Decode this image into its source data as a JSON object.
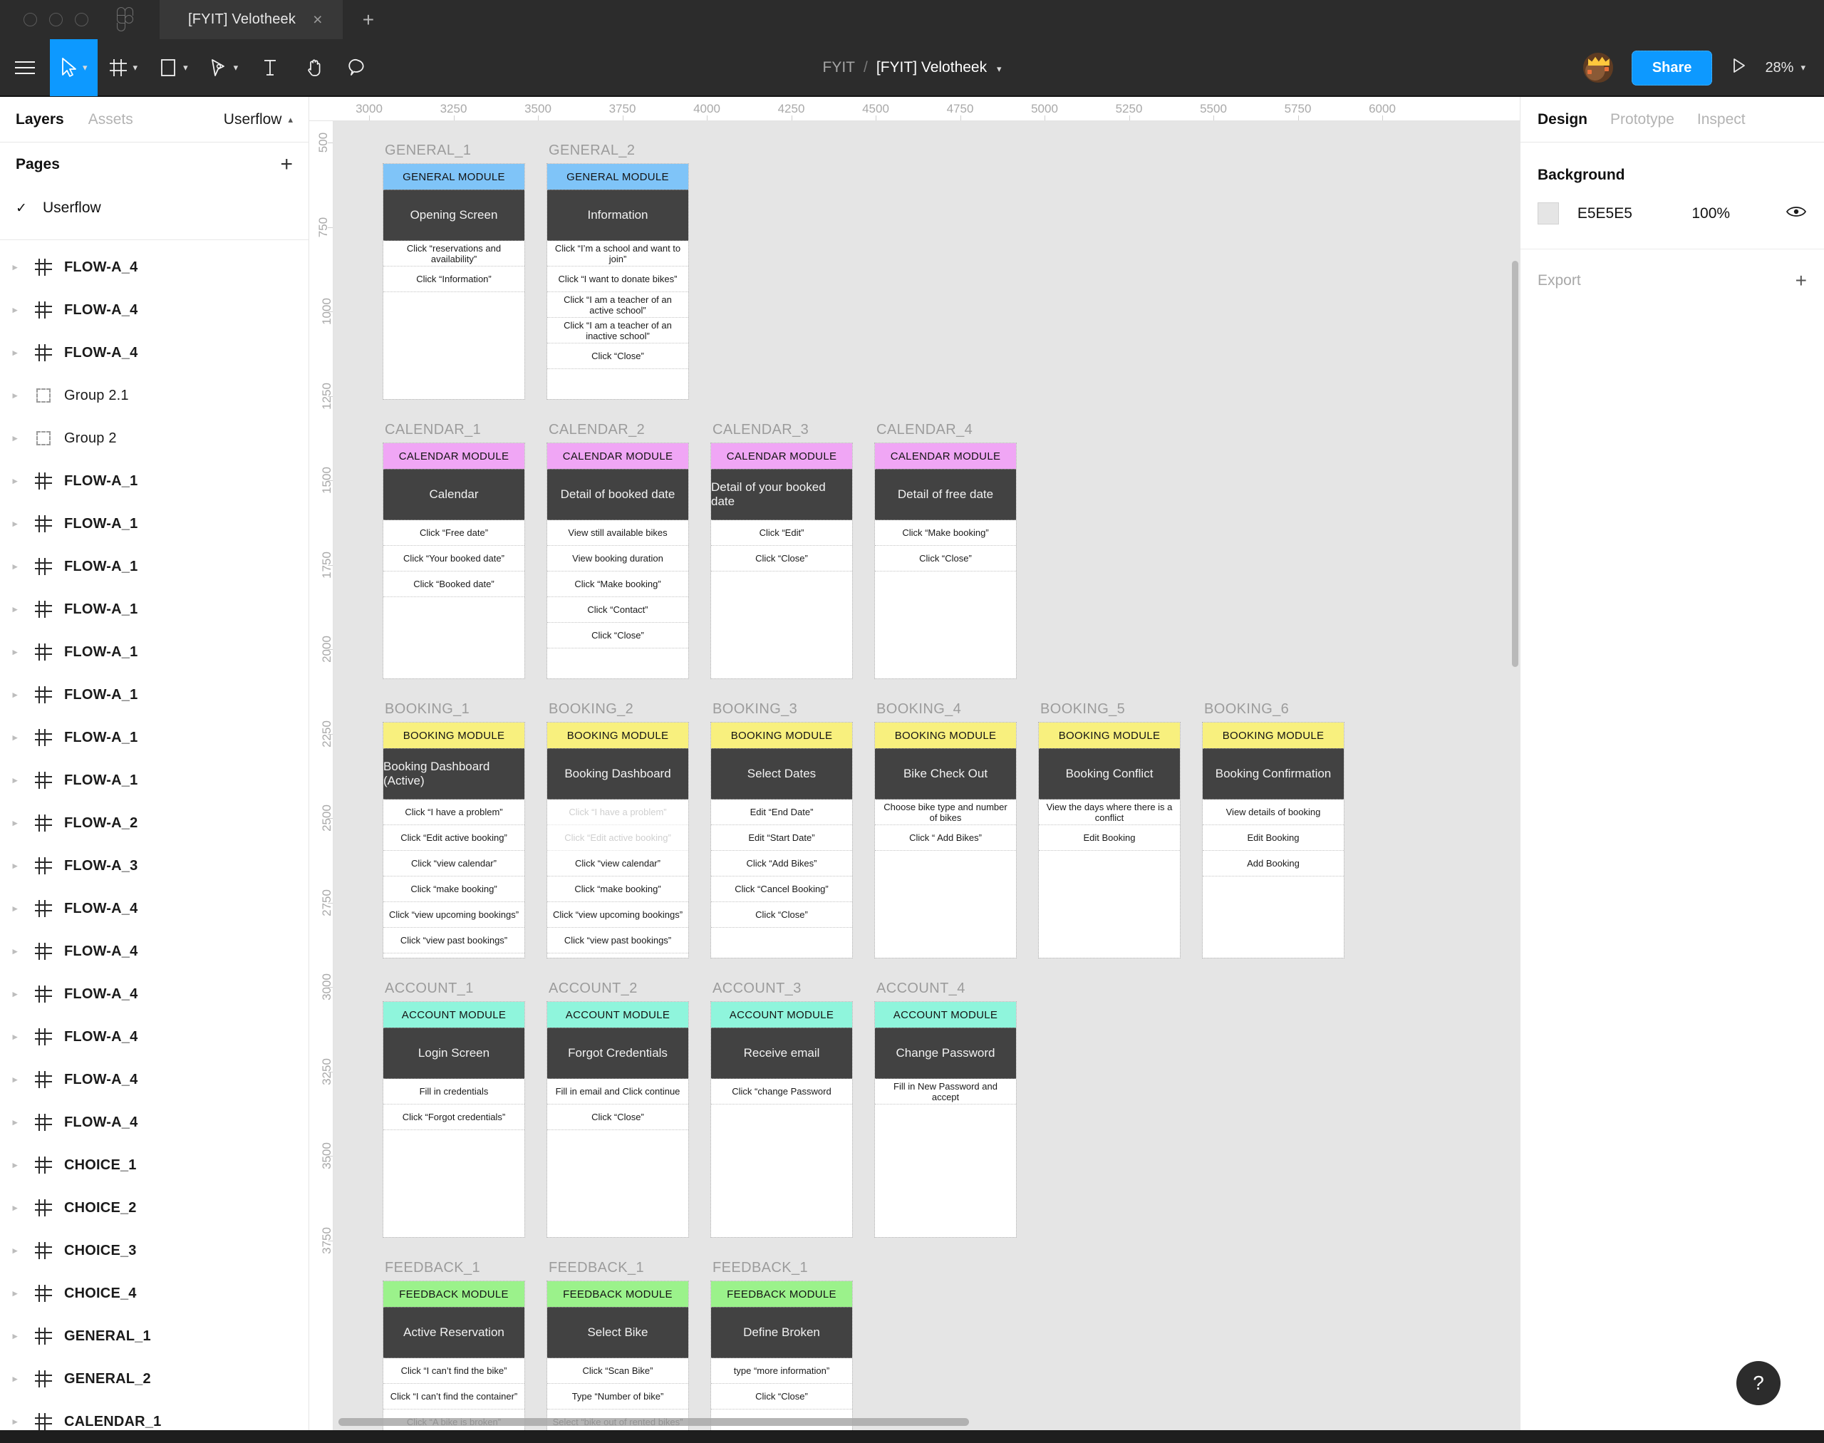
{
  "window": {
    "traffic_lights": [
      "close",
      "minimize",
      "maximize"
    ],
    "app_logo": "figma-logo",
    "tab_title": "[FYIT] Velotheek",
    "tab_close": "×",
    "new_tab": "+"
  },
  "toolbar": {
    "menu_icon": "hamburger-icon",
    "tools": [
      {
        "name": "move-tool",
        "icon": "cursor-arrow-icon",
        "active": true,
        "caret": "∨"
      },
      {
        "name": "frame-tool",
        "icon": "frame-icon",
        "active": false,
        "caret": "∨"
      },
      {
        "name": "shape-tool",
        "icon": "rectangle-icon",
        "active": false,
        "caret": "∨"
      },
      {
        "name": "pen-tool",
        "icon": "pen-icon",
        "active": false,
        "caret": "∨"
      },
      {
        "name": "text-tool",
        "icon": "text-icon",
        "active": false,
        "caret": ""
      },
      {
        "name": "hand-tool",
        "icon": "hand-icon",
        "active": false,
        "caret": ""
      },
      {
        "name": "comment-tool",
        "icon": "comment-icon",
        "active": false,
        "caret": ""
      }
    ],
    "breadcrumb": {
      "team": "FYIT",
      "separator": "/",
      "file": "[FYIT] Velotheek",
      "caret": "∨"
    },
    "avatar": "user-avatar",
    "share_label": "Share",
    "present_icon": "play-icon",
    "zoom_level": "28%",
    "zoom_caret": "∨"
  },
  "left_panel": {
    "tabs": [
      {
        "label": "Layers",
        "active": true
      },
      {
        "label": "Assets",
        "active": false
      }
    ],
    "page_selector": {
      "label": "Userflow",
      "caret": "^"
    },
    "pages": {
      "header": "Pages",
      "add_icon": "plus-icon",
      "items": [
        {
          "label": "Userflow",
          "checked": true,
          "check_glyph": "✓"
        }
      ]
    },
    "layers": [
      {
        "name": "FLOW-A_4",
        "type": "frame"
      },
      {
        "name": "FLOW-A_4",
        "type": "frame"
      },
      {
        "name": "FLOW-A_4",
        "type": "frame"
      },
      {
        "name": "Group 2.1",
        "type": "group"
      },
      {
        "name": "Group 2",
        "type": "group"
      },
      {
        "name": "FLOW-A_1",
        "type": "frame"
      },
      {
        "name": "FLOW-A_1",
        "type": "frame"
      },
      {
        "name": "FLOW-A_1",
        "type": "frame"
      },
      {
        "name": "FLOW-A_1",
        "type": "frame"
      },
      {
        "name": "FLOW-A_1",
        "type": "frame"
      },
      {
        "name": "FLOW-A_1",
        "type": "frame"
      },
      {
        "name": "FLOW-A_1",
        "type": "frame"
      },
      {
        "name": "FLOW-A_1",
        "type": "frame"
      },
      {
        "name": "FLOW-A_2",
        "type": "frame"
      },
      {
        "name": "FLOW-A_3",
        "type": "frame"
      },
      {
        "name": "FLOW-A_4",
        "type": "frame"
      },
      {
        "name": "FLOW-A_4",
        "type": "frame"
      },
      {
        "name": "FLOW-A_4",
        "type": "frame"
      },
      {
        "name": "FLOW-A_4",
        "type": "frame"
      },
      {
        "name": "FLOW-A_4",
        "type": "frame"
      },
      {
        "name": "FLOW-A_4",
        "type": "frame"
      },
      {
        "name": "CHOICE_1",
        "type": "frame"
      },
      {
        "name": "CHOICE_2",
        "type": "frame"
      },
      {
        "name": "CHOICE_3",
        "type": "frame"
      },
      {
        "name": "CHOICE_4",
        "type": "frame"
      },
      {
        "name": "GENERAL_1",
        "type": "frame"
      },
      {
        "name": "GENERAL_2",
        "type": "frame"
      },
      {
        "name": "CALENDAR_1",
        "type": "frame"
      }
    ]
  },
  "right_panel": {
    "tabs": [
      {
        "label": "Design",
        "active": true
      },
      {
        "label": "Prototype",
        "active": false
      },
      {
        "label": "Inspect",
        "active": false
      }
    ],
    "background": {
      "title": "Background",
      "color_hex": "E5E5E5",
      "opacity": "100%",
      "visibility_icon": "eye-icon"
    },
    "export": {
      "title": "Export",
      "add_icon": "plus-icon"
    }
  },
  "canvas": {
    "ruler_h": [
      3000,
      3250,
      3500,
      3750,
      4000,
      4250,
      4500,
      4750,
      5000,
      5250,
      5500,
      5750,
      6000
    ],
    "ruler_v": [
      500,
      750,
      1000,
      1250,
      1500,
      1750,
      2000,
      2250,
      2500,
      2750,
      3000,
      3250,
      3500,
      3750
    ],
    "module_colors": {
      "general": "#7FC4F8",
      "calendar": "#F0A6F5",
      "booking": "#F8F07E",
      "account": "#8FF5DC",
      "feedback": "#9BF28B"
    },
    "frames": [
      {
        "name": "GENERAL_1",
        "module": "GENERAL MODULE",
        "module_key": "general",
        "title": "Opening Screen",
        "rows": [
          {
            "text": "Click “reservations and availability”",
            "disabled": false
          },
          {
            "text": "Click “Information”",
            "disabled": false
          }
        ]
      },
      {
        "name": "GENERAL_2",
        "module": "GENERAL MODULE",
        "module_key": "general",
        "title": "Information",
        "rows": [
          {
            "text": "Click “I’m a school and want to join”",
            "disabled": false
          },
          {
            "text": "Click “I want to donate bikes”",
            "disabled": false
          },
          {
            "text": "Click “I am a teacher of an active school”",
            "disabled": false
          },
          {
            "text": "Click “I am a teacher of an inactive school”",
            "disabled": false
          },
          {
            "text": "Click “Close”",
            "disabled": false
          }
        ]
      },
      {
        "name": "CALENDAR_1",
        "module": "CALENDAR MODULE",
        "module_key": "calendar",
        "title": "Calendar",
        "rows": [
          {
            "text": "Click “Free date”",
            "disabled": false
          },
          {
            "text": "Click “Your booked date”",
            "disabled": false
          },
          {
            "text": "Click “Booked date”",
            "disabled": false
          }
        ]
      },
      {
        "name": "CALENDAR_2",
        "module": "CALENDAR MODULE",
        "module_key": "calendar",
        "title": "Detail of booked date",
        "rows": [
          {
            "text": "View still available bikes",
            "disabled": false
          },
          {
            "text": "View booking duration",
            "disabled": false
          },
          {
            "text": "Click “Make booking”",
            "disabled": false
          },
          {
            "text": "Click “Contact”",
            "disabled": false
          },
          {
            "text": "Click “Close”",
            "disabled": false
          }
        ]
      },
      {
        "name": "CALENDAR_3",
        "module": "CALENDAR MODULE",
        "module_key": "calendar",
        "title": "Detail of your booked date",
        "rows": [
          {
            "text": "Click “Edit”",
            "disabled": false
          },
          {
            "text": "Click “Close”",
            "disabled": false
          }
        ]
      },
      {
        "name": "CALENDAR_4",
        "module": "CALENDAR MODULE",
        "module_key": "calendar",
        "title": "Detail of free date",
        "rows": [
          {
            "text": "Click “Make booking”",
            "disabled": false
          },
          {
            "text": "Click “Close”",
            "disabled": false
          }
        ]
      },
      {
        "name": "BOOKING_1",
        "module": "BOOKING MODULE",
        "module_key": "booking",
        "title": "Booking Dashboard (Active)",
        "rows": [
          {
            "text": "Click “I have a problem”",
            "disabled": false
          },
          {
            "text": "Click “Edit active booking”",
            "disabled": false
          },
          {
            "text": "Click “view calendar”",
            "disabled": false
          },
          {
            "text": "Click “make booking”",
            "disabled": false
          },
          {
            "text": "Click “view upcoming bookings”",
            "disabled": false
          },
          {
            "text": "Click “view past bookings”",
            "disabled": false
          }
        ]
      },
      {
        "name": "BOOKING_2",
        "module": "BOOKING MODULE",
        "module_key": "booking",
        "title": "Booking Dashboard",
        "rows": [
          {
            "text": "Click “I have a problem”",
            "disabled": true
          },
          {
            "text": "Click “Edit active booking”",
            "disabled": true
          },
          {
            "text": "Click “view calendar”",
            "disabled": false
          },
          {
            "text": "Click “make booking”",
            "disabled": false
          },
          {
            "text": "Click “view upcoming bookings”",
            "disabled": false
          },
          {
            "text": "Click “view past bookings”",
            "disabled": false
          }
        ]
      },
      {
        "name": "BOOKING_3",
        "module": "BOOKING MODULE",
        "module_key": "booking",
        "title": "Select Dates",
        "rows": [
          {
            "text": "Edit “End Date”",
            "disabled": false
          },
          {
            "text": "Edit “Start Date”",
            "disabled": false
          },
          {
            "text": "Click “Add Bikes”",
            "disabled": false
          },
          {
            "text": "Click “Cancel Booking”",
            "disabled": false
          },
          {
            "text": "Click “Close”",
            "disabled": false
          }
        ]
      },
      {
        "name": "BOOKING_4",
        "module": "BOOKING MODULE",
        "module_key": "booking",
        "title": "Bike Check Out",
        "rows": [
          {
            "text": "Choose bike type and number of bikes",
            "disabled": false
          },
          {
            "text": "Click “ Add Bikes”",
            "disabled": false
          }
        ]
      },
      {
        "name": "BOOKING_5",
        "module": "BOOKING MODULE",
        "module_key": "booking",
        "title": "Booking Conflict",
        "rows": [
          {
            "text": "View the days where there is a conflict",
            "disabled": false
          },
          {
            "text": "Edit Booking",
            "disabled": false
          }
        ]
      },
      {
        "name": "BOOKING_6",
        "module": "BOOKING MODULE",
        "module_key": "booking",
        "title": "Booking Confirmation",
        "rows": [
          {
            "text": "View details of booking",
            "disabled": false
          },
          {
            "text": "Edit Booking",
            "disabled": false
          },
          {
            "text": "Add Booking",
            "disabled": false
          }
        ]
      },
      {
        "name": "ACCOUNT_1",
        "module": "ACCOUNT MODULE",
        "module_key": "account",
        "title": "Login Screen",
        "rows": [
          {
            "text": "Fill in credentials",
            "disabled": false
          },
          {
            "text": "Click “Forgot credentials”",
            "disabled": false
          }
        ]
      },
      {
        "name": "ACCOUNT_2",
        "module": "ACCOUNT MODULE",
        "module_key": "account",
        "title": "Forgot Credentials",
        "rows": [
          {
            "text": "Fill in email and Click continue",
            "disabled": false
          },
          {
            "text": "Click “Close”",
            "disabled": false
          }
        ]
      },
      {
        "name": "ACCOUNT_3",
        "module": "ACCOUNT MODULE",
        "module_key": "account",
        "title": "Receive email",
        "rows": [
          {
            "text": "Click “change Password",
            "disabled": false
          }
        ]
      },
      {
        "name": "ACCOUNT_4",
        "module": "ACCOUNT MODULE",
        "module_key": "account",
        "title": "Change Password",
        "rows": [
          {
            "text": "Fill in New Password and accept",
            "disabled": false
          }
        ]
      },
      {
        "name": "FEEDBACK_1",
        "module": "FEEDBACK MODULE",
        "module_key": "feedback",
        "title": "Active Reservation",
        "rows": [
          {
            "text": "Click “I can’t find the bike”",
            "disabled": false
          },
          {
            "text": "Click “I can’t find the container”",
            "disabled": false
          },
          {
            "text": "Click “A bike is broken”",
            "disabled": false
          }
        ]
      },
      {
        "name": "FEEDBACK_1",
        "module": "FEEDBACK MODULE",
        "module_key": "feedback",
        "title": "Select Bike",
        "rows": [
          {
            "text": "Click “Scan Bike”",
            "disabled": false
          },
          {
            "text": "Type “Number of bike”",
            "disabled": false
          },
          {
            "text": "Select “bike out of rented bikes”",
            "disabled": false
          }
        ]
      },
      {
        "name": "FEEDBACK_1",
        "module": "FEEDBACK MODULE",
        "module_key": "feedback",
        "title": "Define Broken",
        "rows": [
          {
            "text": "type “more information”",
            "disabled": false
          },
          {
            "text": "Click “Close”",
            "disabled": false
          }
        ]
      }
    ]
  },
  "help_button": {
    "glyph": "?",
    "name": "help-icon"
  }
}
